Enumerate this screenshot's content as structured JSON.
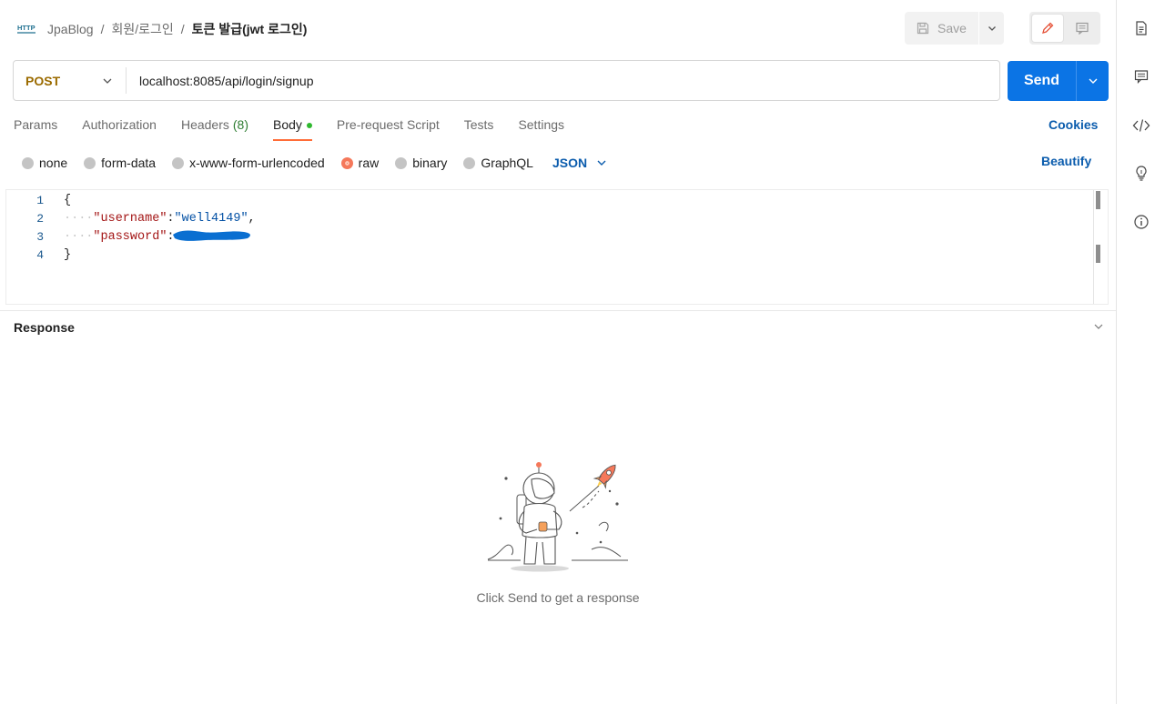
{
  "breadcrumb": {
    "badge": "HTTP",
    "collection": "JpaBlog",
    "folder": "회원/로그인",
    "request": "토큰 발급(jwt 로그인)",
    "separator": "/"
  },
  "header": {
    "save_label": "Save"
  },
  "request": {
    "method": "POST",
    "url": "localhost:8085/api/login/signup",
    "send_label": "Send"
  },
  "tabs": [
    {
      "label": "Params"
    },
    {
      "label": "Authorization"
    },
    {
      "label": "Headers",
      "count": "(8)"
    },
    {
      "label": "Body",
      "active": true
    },
    {
      "label": "Pre-request Script"
    },
    {
      "label": "Tests"
    },
    {
      "label": "Settings"
    }
  ],
  "cookies_label": "Cookies",
  "body_types": {
    "options": [
      "none",
      "form-data",
      "x-www-form-urlencoded",
      "raw",
      "binary",
      "GraphQL"
    ],
    "selected": "raw",
    "format": "JSON",
    "beautify_label": "Beautify"
  },
  "editor": {
    "line_numbers": [
      "1",
      "2",
      "3",
      "4"
    ],
    "lines": {
      "open": "{",
      "indent": "····",
      "username_key": "\"username\"",
      "username_value": "\"well4149\"",
      "password_key": "\"password\"",
      "colon": ":",
      "comma": ",",
      "close": "}"
    }
  },
  "response": {
    "title": "Response",
    "empty_message": "Click Send to get a response"
  },
  "colors": {
    "accent_orange": "#ff6c37",
    "send_blue": "#0b74e5",
    "link_blue": "#0b5cad",
    "method_post": "#9b6b00",
    "body_dot_green": "#2eb82e"
  },
  "icons": {
    "right_sidebar": [
      "documentation-icon",
      "comments-icon",
      "code-icon",
      "lightbulb-icon",
      "info-icon"
    ]
  }
}
